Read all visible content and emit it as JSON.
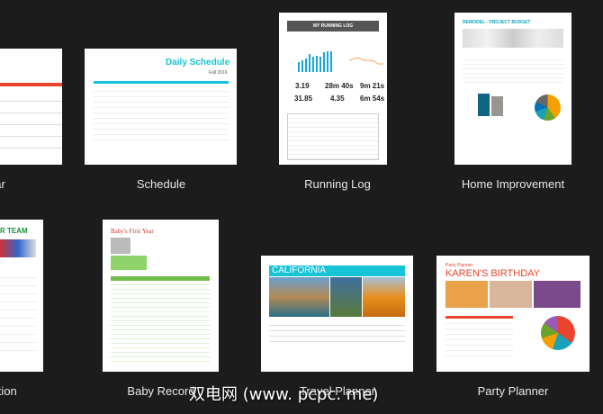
{
  "templates": [
    {
      "label": "Calendar",
      "visible_label": "ar"
    },
    {
      "label": "Schedule",
      "title": "Daily Schedule",
      "subtitle": "Fall 2016"
    },
    {
      "label": "Running Log",
      "title": "MY RUNNING LOG",
      "stats": [
        "3.19",
        "28m 40s",
        "9m 21s",
        "31.85",
        "4.35",
        "6m 54s"
      ]
    },
    {
      "label": "Home Improvement",
      "title": "REMODEL - PROJECT BUDGET"
    },
    {
      "label": "Team Organization",
      "visible_label": "ization",
      "title": "R TEAM"
    },
    {
      "label": "Baby Record",
      "title": "Baby's First Year"
    },
    {
      "label": "Travel Planner",
      "title": "CALIFORNIA"
    },
    {
      "label": "Party Planner",
      "title": "KAREN'S BIRTHDAY",
      "subtitle": "Party Planner"
    }
  ],
  "watermark": "双电网 (www. pcpc. me)",
  "colors": {
    "background": "#1c1c1c",
    "accent_cyan": "#17c3d6",
    "party_red": "#e8452c"
  }
}
